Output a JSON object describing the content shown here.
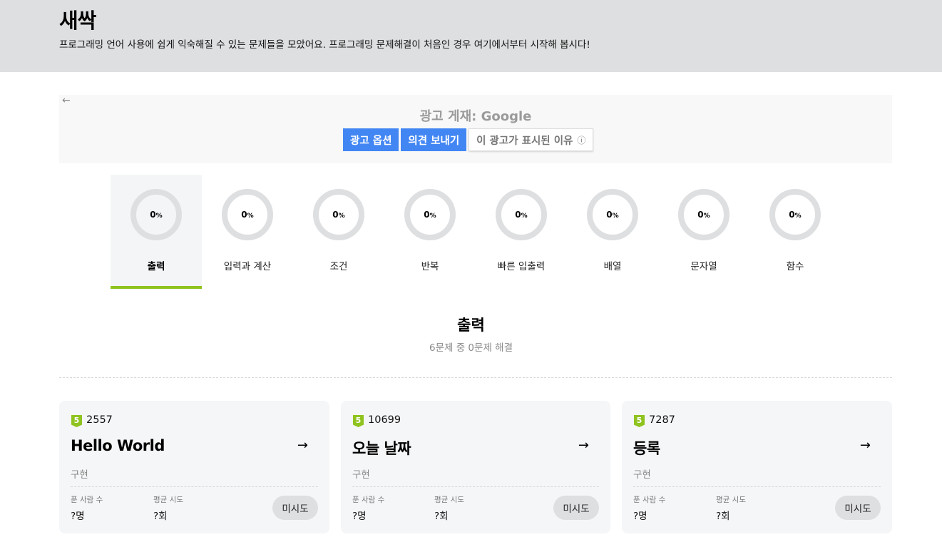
{
  "header": {
    "title": "새싹",
    "description": "프로그래밍 언어 사용에 쉽게 익숙해질 수 있는 문제들을 모았어요. 프로그래밍 문제해결이 처음인 경우 여기에서부터 시작해 봅시다!"
  },
  "ad": {
    "label": "광고 게재: Google",
    "options_label": "광고 옵션",
    "feedback_label": "의견 보내기",
    "why_label": "이 광고가 표시된 이유",
    "back_icon": "←",
    "info_icon": "ⓘ"
  },
  "categories": [
    {
      "label": "출력",
      "progress": "0",
      "unit": "%"
    },
    {
      "label": "입력과 계산",
      "progress": "0",
      "unit": "%"
    },
    {
      "label": "조건",
      "progress": "0",
      "unit": "%"
    },
    {
      "label": "반복",
      "progress": "0",
      "unit": "%"
    },
    {
      "label": "빠른 입출력",
      "progress": "0",
      "unit": "%"
    },
    {
      "label": "배열",
      "progress": "0",
      "unit": "%"
    },
    {
      "label": "문자열",
      "progress": "0",
      "unit": "%"
    },
    {
      "label": "함수",
      "progress": "0",
      "unit": "%"
    }
  ],
  "section": {
    "title": "출력",
    "subtitle": "6문제 중 0문제 해결"
  },
  "cards": [
    {
      "level": "5",
      "count": "2557",
      "title": "Hello World",
      "type": "구현",
      "solvers_label": "푼 사람 수",
      "solvers": "?명",
      "attempts_label": "평균 시도",
      "attempts": "?회",
      "status": "미시도",
      "arrow": "→"
    },
    {
      "level": "5",
      "count": "10699",
      "title": "오늘 날짜",
      "type": "구현",
      "solvers_label": "푼 사람 수",
      "solvers": "?명",
      "attempts_label": "평균 시도",
      "attempts": "?회",
      "status": "미시도",
      "arrow": "→"
    },
    {
      "level": "5",
      "count": "7287",
      "title": "등록",
      "type": "구현",
      "solvers_label": "푼 사람 수",
      "solvers": "?명",
      "attempts_label": "평균 시도",
      "attempts": "?회",
      "status": "미시도",
      "arrow": "→"
    }
  ],
  "colors": {
    "accent": "#8fc31f",
    "ad_button": "#4286f4",
    "header_bg": "#dedfe1"
  }
}
